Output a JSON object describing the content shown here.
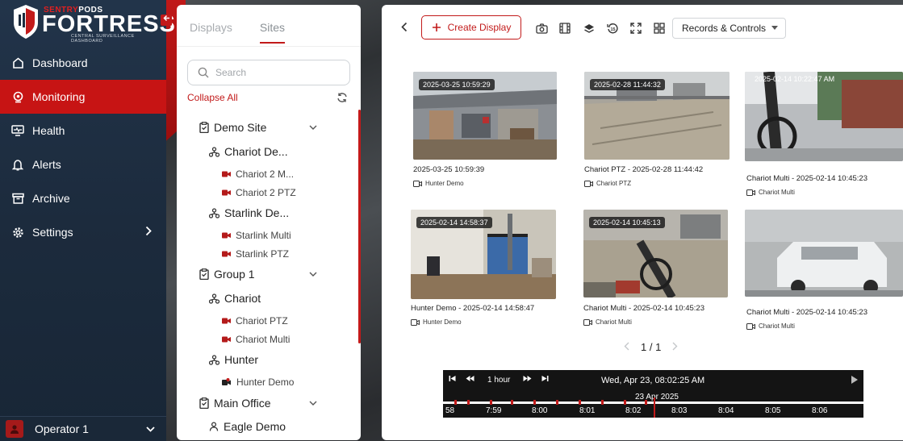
{
  "app": {
    "brand_small_a": "SENTRY",
    "brand_small_b": "PODS",
    "brand": "FORTRESS",
    "brand_sub": "CENTRAL SURVEILLANCE DASHBOARD"
  },
  "sidebar": {
    "items": [
      {
        "label": "Dashboard",
        "icon": "dashboard-icon",
        "active": false
      },
      {
        "label": "Monitoring",
        "icon": "monitoring-icon",
        "active": true
      },
      {
        "label": "Health",
        "icon": "health-icon",
        "active": false
      },
      {
        "label": "Alerts",
        "icon": "alerts-icon",
        "active": false
      },
      {
        "label": "Archive",
        "icon": "archive-icon",
        "active": false
      },
      {
        "label": "Settings",
        "icon": "settings-icon",
        "active": false
      }
    ],
    "operator": "Operator 1"
  },
  "tree_panel": {
    "tabs": [
      {
        "label": "Displays"
      },
      {
        "label": "Sites"
      }
    ],
    "search_placeholder": "Search",
    "collapse_all": "Collapse All",
    "nodes": [
      {
        "label": "Demo Site",
        "level": 0,
        "type": "site"
      },
      {
        "label": "Chariot De...",
        "level": 1,
        "type": "group"
      },
      {
        "label": "Chariot 2 M...",
        "level": 2,
        "type": "camera"
      },
      {
        "label": "Chariot 2 PTZ",
        "level": 2,
        "type": "camera"
      },
      {
        "label": "Starlink De...",
        "level": 1,
        "type": "group"
      },
      {
        "label": "Starlink Multi",
        "level": 2,
        "type": "camera"
      },
      {
        "label": "Starlink PTZ",
        "level": 2,
        "type": "camera"
      },
      {
        "label": "Group 1",
        "level": 0,
        "type": "site"
      },
      {
        "label": "Chariot",
        "level": 1,
        "type": "group"
      },
      {
        "label": "Chariot PTZ",
        "level": 2,
        "type": "camera"
      },
      {
        "label": "Chariot Multi",
        "level": 2,
        "type": "camera"
      },
      {
        "label": "Hunter",
        "level": 1,
        "type": "group"
      },
      {
        "label": "Hunter Demo",
        "level": 2,
        "type": "camera"
      },
      {
        "label": "Main Office",
        "level": 0,
        "type": "site"
      },
      {
        "label": "Eagle Demo",
        "level": 1,
        "type": "person"
      }
    ]
  },
  "main": {
    "create_display": "Create Display",
    "records_controls": "Records & Controls",
    "cameras": [
      {
        "overlay": "2025-03-25 10:59:29",
        "title": "2025-03-25 10:59:39",
        "sub": "Hunter Demo"
      },
      {
        "overlay": "2025-02-28 11:44:32",
        "title": "Chariot PTZ - 2025-02-28 11:44:42",
        "sub": "Chariot PTZ"
      },
      {
        "overlay": "2025-02-14 10:22:47 AM",
        "title": "Chariot Multi - 2025-02-14 10:45:23",
        "sub": "Chariot Multi"
      },
      {
        "overlay": "2025-02-14 14:58:37",
        "title": "Hunter Demo - 2025-02-14 14:58:47",
        "sub": "Hunter Demo"
      },
      {
        "overlay": "2025-02-14 10:45:13",
        "title": "Chariot Multi - 2025-02-14 10:45:23",
        "sub": "Chariot Multi"
      },
      {
        "overlay": "",
        "title": "Chariot Multi - 2025-02-14 10:45:23",
        "sub": "Chariot Multi"
      }
    ],
    "pager": "1 / 1"
  },
  "timeline": {
    "range": "1 hour",
    "current": "Wed, Apr 23, 08:02:25 AM",
    "date": "23 Apr 2025",
    "labels": [
      "58",
      "7:59",
      "8:00",
      "8:01",
      "8:02",
      "8:03",
      "8:04",
      "8:05",
      "8:06"
    ]
  }
}
